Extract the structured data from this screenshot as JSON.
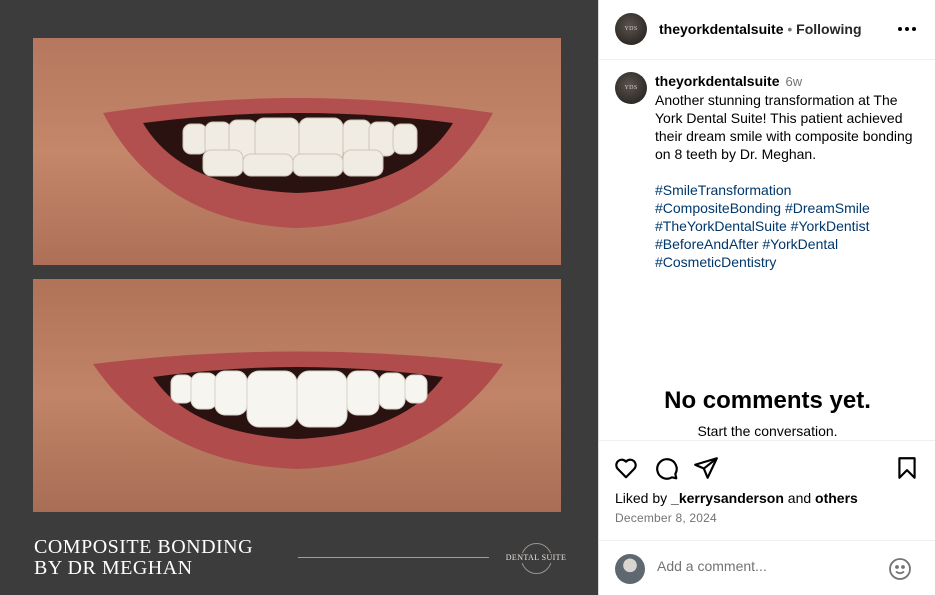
{
  "media": {
    "caption_line1": "COMPOSITE BONDING",
    "caption_line2": "BY DR MEGHAN",
    "logo_text": "DENTAL SUITE",
    "background": "#3c3c3c",
    "accent_line": "#b89685"
  },
  "header": {
    "username": "theyorkdentalsuite",
    "separator": "•",
    "follow_status": "Following",
    "more_icon": "more-horizontal-icon"
  },
  "post": {
    "username": "theyorkdentalsuite",
    "time": "6w",
    "caption": "Another stunning transformation at The York Dental Suite! This patient achieved their dream smile with composite bonding on 8 teeth by Dr. Meghan.",
    "hashtags": [
      "#SmileTransformation",
      "#CompositeBonding #DreamSmile",
      "#TheYorkDentalSuite #YorkDentist",
      "#BeforeAndAfter #YorkDental",
      "#CosmeticDentistry"
    ]
  },
  "comments": {
    "empty_title": "No comments yet.",
    "empty_sub": "Start the conversation."
  },
  "actions": {
    "icons": [
      "heart-icon",
      "comment-icon",
      "share-icon",
      "bookmark-icon"
    ],
    "liked_prefix": "Liked by ",
    "liked_user": "_kerrysanderson",
    "liked_and": " and ",
    "liked_others": "others",
    "date": "December 8, 2024"
  },
  "add_comment": {
    "placeholder": "Add a comment...",
    "emoji_icon": "emoji-icon"
  },
  "colors": {
    "hashtag": "#00376b",
    "muted": "#737373",
    "border": "#efefef"
  }
}
